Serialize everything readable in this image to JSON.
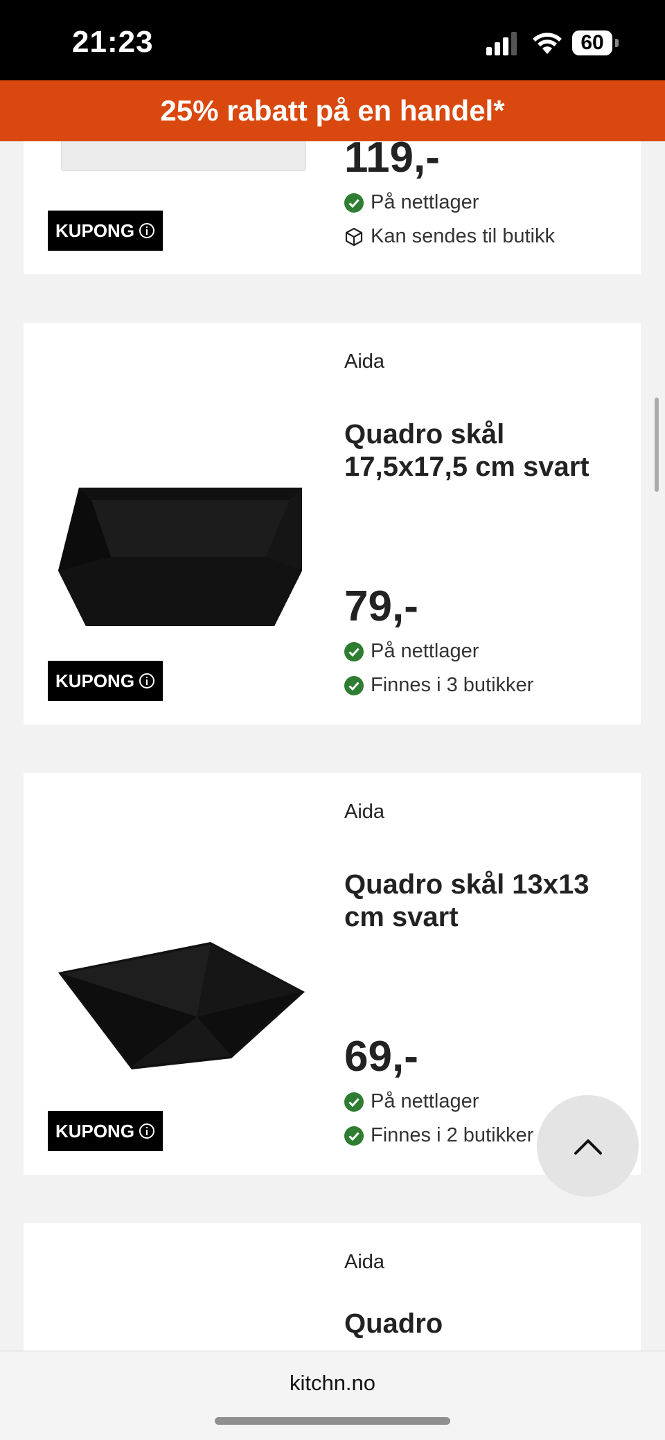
{
  "status_bar": {
    "time": "21:23",
    "battery": "60"
  },
  "promo": {
    "text": "25% rabatt på en handel*"
  },
  "products": [
    {
      "price": "119,-",
      "stock": [
        {
          "icon": "check-circle-icon",
          "text": "På nettlager"
        },
        {
          "icon": "box-icon",
          "text": "Kan sendes til butikk"
        }
      ],
      "coupon": "KUPONG"
    },
    {
      "brand": "Aida",
      "title": "Quadro skål 17,5x17,5 cm svart",
      "price": "79,-",
      "stock": [
        {
          "icon": "check-circle-icon",
          "text": "På nettlager"
        },
        {
          "icon": "check-circle-icon",
          "text": "Finnes i 3 butikker"
        }
      ],
      "coupon": "KUPONG"
    },
    {
      "brand": "Aida",
      "title": "Quadro skål 13x13 cm svart",
      "price": "69,-",
      "stock": [
        {
          "icon": "check-circle-icon",
          "text": "På nettlager"
        },
        {
          "icon": "check-circle-icon",
          "text": "Finnes i 2 butikker"
        }
      ],
      "coupon": "KUPONG"
    },
    {
      "brand": "Aida",
      "title": "Quadro"
    }
  ],
  "browser": {
    "url": "kitchn.no"
  },
  "colors": {
    "promo": "#d9480f",
    "check": "#2e7d32",
    "coupon_bg": "#000000"
  }
}
